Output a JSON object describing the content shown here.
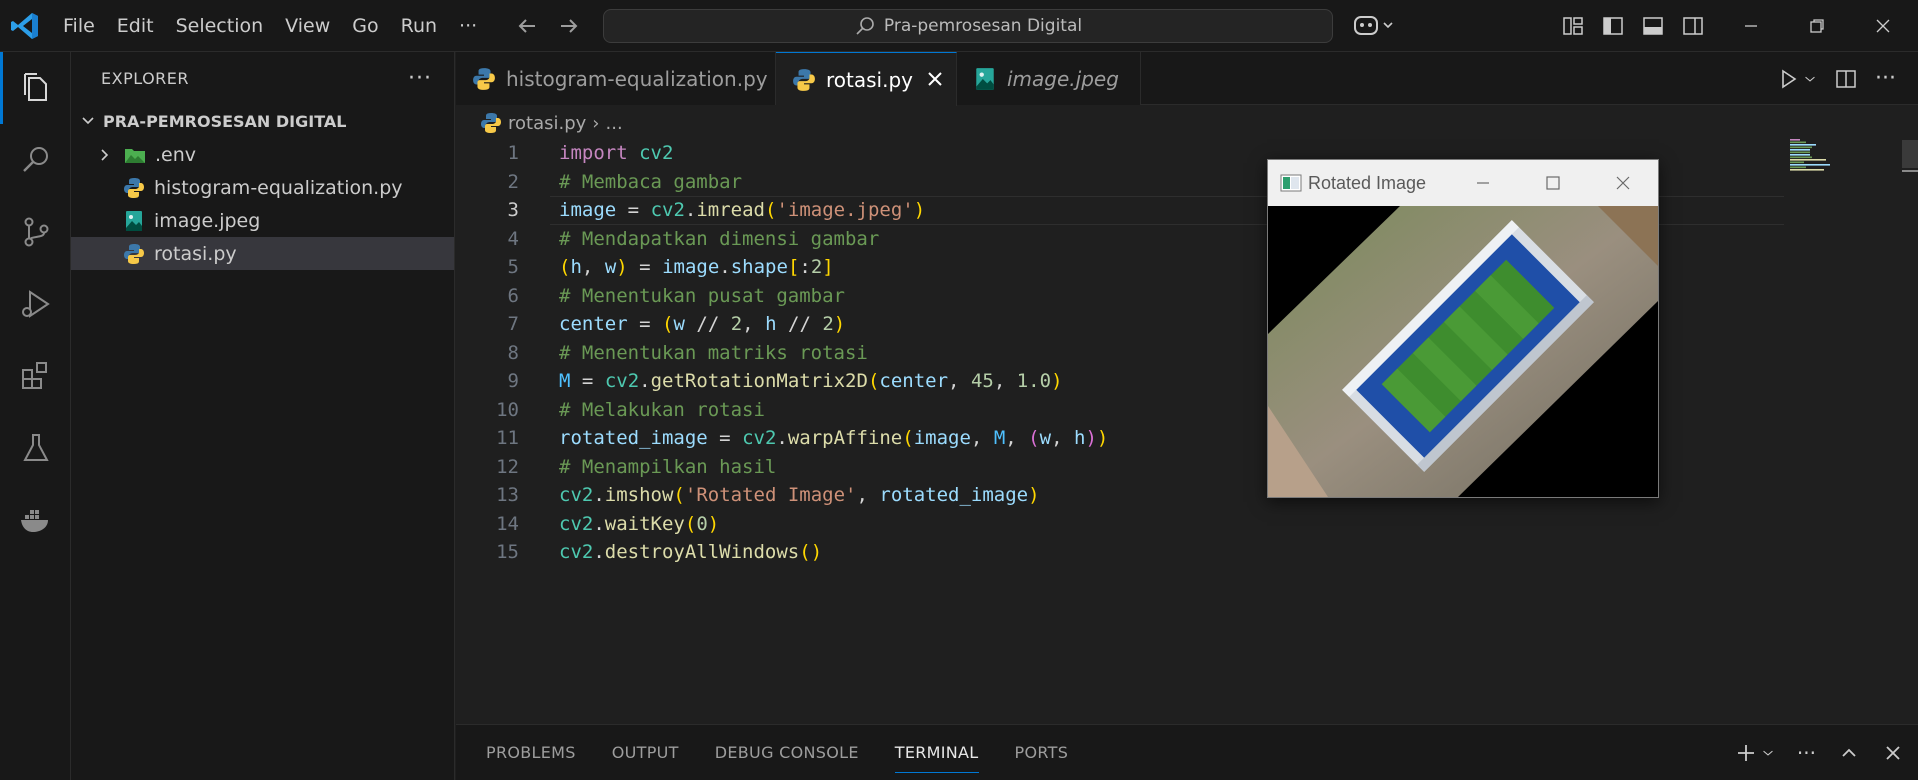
{
  "menu": [
    "File",
    "Edit",
    "Selection",
    "View",
    "Go",
    "Run",
    "···"
  ],
  "search": {
    "placeholder": "Pra-pemrosesan Digital"
  },
  "sidebar": {
    "title": "EXPLORER",
    "folder": "PRA-PEMROSESAN DIGITAL",
    "items": [
      {
        "label": ".env",
        "type": "folder"
      },
      {
        "label": "histogram-equalization.py",
        "type": "python"
      },
      {
        "label": "image.jpeg",
        "type": "image"
      },
      {
        "label": "rotasi.py",
        "type": "python",
        "selected": true
      }
    ]
  },
  "tabs": [
    {
      "label": "histogram-equalization.py",
      "icon": "python-icon"
    },
    {
      "label": "rotasi.py",
      "icon": "python-icon",
      "active": true
    },
    {
      "label": "image.jpeg",
      "icon": "image-icon",
      "preview": true
    }
  ],
  "breadcrumb": {
    "file": "rotasi.py",
    "sep": "›",
    "rest": "..."
  },
  "editor": {
    "current_line": 3,
    "lines": [
      {
        "n": "1",
        "text": "import cv2"
      },
      {
        "n": "2",
        "text": "# Membaca gambar"
      },
      {
        "n": "3",
        "text": "image = cv2.imread('image.jpeg')"
      },
      {
        "n": "4",
        "text": "# Mendapatkan dimensi gambar"
      },
      {
        "n": "5",
        "text": "(h, w) = image.shape[:2]"
      },
      {
        "n": "6",
        "text": "# Menentukan pusat gambar"
      },
      {
        "n": "7",
        "text": "center = (w // 2, h // 2)"
      },
      {
        "n": "8",
        "text": "# Menentukan matriks rotasi"
      },
      {
        "n": "9",
        "text": "M = cv2.getRotationMatrix2D(center, 45, 1.0)"
      },
      {
        "n": "10",
        "text": "# Melakukan rotasi"
      },
      {
        "n": "11",
        "text": "rotated_image = cv2.warpAffine(image, M, (w, h))"
      },
      {
        "n": "12",
        "text": "# Menampilkan hasil"
      },
      {
        "n": "13",
        "text": "cv2.imshow('Rotated Image', rotated_image)"
      },
      {
        "n": "14",
        "text": "cv2.waitKey(0)"
      },
      {
        "n": "15",
        "text": "cv2.destroyAllWindows()"
      }
    ]
  },
  "image_window": {
    "title": "Rotated Image"
  },
  "panel": {
    "tabs": [
      "PROBLEMS",
      "OUTPUT",
      "DEBUG CONSOLE",
      "TERMINAL",
      "PORTS"
    ],
    "active": "TERMINAL"
  },
  "colors": {
    "accent": "#0078d4",
    "background": "#1f1f1f",
    "sidebar": "#181818"
  }
}
